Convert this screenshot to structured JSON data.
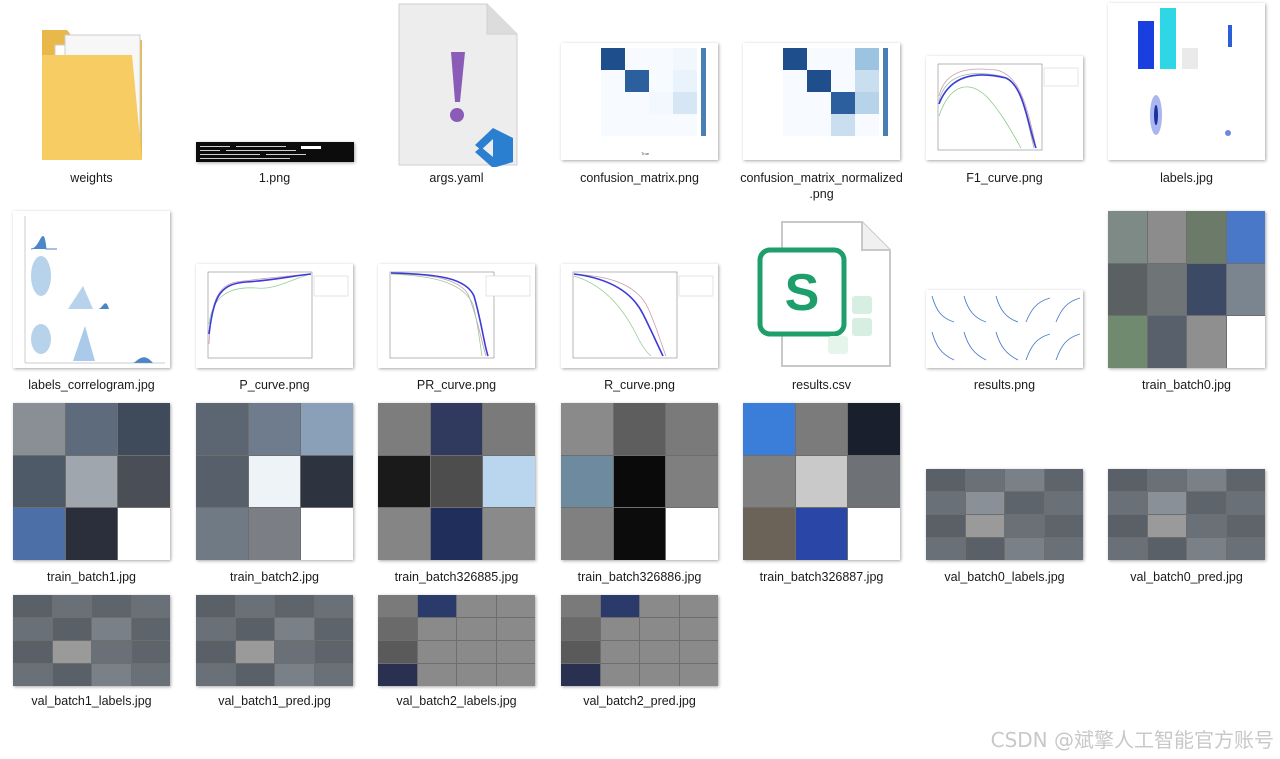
{
  "files": [
    {
      "name": "weights",
      "kind": "folder-icon"
    },
    {
      "name": "1.png",
      "kind": "terminal-image"
    },
    {
      "name": "args.yaml",
      "kind": "yaml-file-icon"
    },
    {
      "name": "confusion_matrix.png",
      "kind": "heatmap-image"
    },
    {
      "name": "confusion_matrix_normalized\n.png",
      "kind": "heatmap-image"
    },
    {
      "name": "F1_curve.png",
      "kind": "curve-image"
    },
    {
      "name": "labels.jpg",
      "kind": "labels-image"
    },
    {
      "name": "labels_correlogram.jpg",
      "kind": "correlogram-image"
    },
    {
      "name": "P_curve.png",
      "kind": "curve-image"
    },
    {
      "name": "PR_curve.png",
      "kind": "curve-image"
    },
    {
      "name": "R_curve.png",
      "kind": "curve-image"
    },
    {
      "name": "results.csv",
      "kind": "csv-file-icon"
    },
    {
      "name": "results.png",
      "kind": "results-image"
    },
    {
      "name": "train_batch0.jpg",
      "kind": "photo-grid-image"
    },
    {
      "name": "train_batch1.jpg",
      "kind": "photo-grid-image"
    },
    {
      "name": "train_batch2.jpg",
      "kind": "photo-grid-image"
    },
    {
      "name": "train_batch326885.jpg",
      "kind": "photo-grid-image"
    },
    {
      "name": "train_batch326886.jpg",
      "kind": "photo-grid-image"
    },
    {
      "name": "train_batch326887.jpg",
      "kind": "photo-grid-image"
    },
    {
      "name": "val_batch0_labels.jpg",
      "kind": "photo-grid-image"
    },
    {
      "name": "val_batch0_pred.jpg",
      "kind": "photo-grid-image"
    },
    {
      "name": "val_batch1_labels.jpg",
      "kind": "photo-grid-image"
    },
    {
      "name": "val_batch1_pred.jpg",
      "kind": "photo-grid-image"
    },
    {
      "name": "val_batch2_labels.jpg",
      "kind": "photo-grid-image"
    },
    {
      "name": "val_batch2_pred.jpg",
      "kind": "photo-grid-image"
    }
  ],
  "watermark": "CSDN @斌擎人工智能官方账号",
  "colors": {
    "heatmap": "#1f4e8c",
    "curve": "#3b3bdc",
    "csv": "#1d9e6a",
    "yaml": "#8a5cb8",
    "vscode": "#2b7fd0",
    "folder": "#f1c65a"
  }
}
